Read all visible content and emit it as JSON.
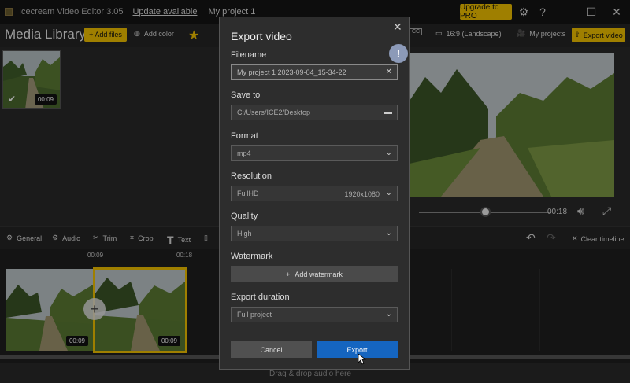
{
  "titlebar": {
    "app_title": "Icecream Video Editor 3.05",
    "update_link": "Update available",
    "project_name": "My project 1",
    "upgrade_label": "Upgrade to PRO"
  },
  "toolbar": {
    "media_library_title": "Media Library",
    "add_files_label": "+ Add files",
    "add_color_label": "Add color",
    "aspect_label": "16:9 (Landscape)",
    "my_projects_label": "My projects",
    "export_video_label": "Export video",
    "cc_label": "CC"
  },
  "library": {
    "thumb_duration": "00:09"
  },
  "preview": {
    "current_time": "00:18",
    "progress": 0.5
  },
  "edit_tools": {
    "general": "General",
    "audio": "Audio",
    "trim": "Trim",
    "crop": "Crop",
    "text": "Text",
    "clear_timeline": "Clear timeline"
  },
  "timeline": {
    "ruler_labels": [
      "00:09",
      "00:18"
    ],
    "clips": [
      {
        "duration": "00:09",
        "selected": false
      },
      {
        "duration": "00:09",
        "selected": true
      }
    ],
    "audio_drop_text": "Drag & drop audio here"
  },
  "dialog": {
    "title": "Export video",
    "filename_label": "Filename",
    "filename_value": "My project 1 2023-09-04_15-34-22",
    "save_to_label": "Save to",
    "save_to_value": "C:/Users/ICE2/Desktop",
    "format_label": "Format",
    "format_value": "mp4",
    "resolution_label": "Resolution",
    "resolution_value": "FullHD",
    "resolution_dims": "1920x1080",
    "quality_label": "Quality",
    "quality_value": "High",
    "watermark_label": "Watermark",
    "add_watermark_label": "Add watermark",
    "export_duration_label": "Export duration",
    "export_duration_value": "Full project",
    "cancel_label": "Cancel",
    "export_label": "Export",
    "info_glyph": "!"
  },
  "colors": {
    "accent_yellow": "#f5c400",
    "export_blue": "#1565c0"
  }
}
